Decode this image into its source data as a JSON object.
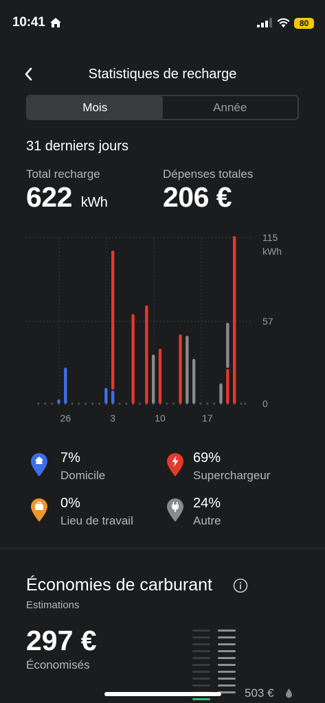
{
  "status_bar": {
    "time": "10:41",
    "battery": "80"
  },
  "header": {
    "title": "Statistiques de recharge"
  },
  "tabs": [
    {
      "label": "Mois",
      "active": true
    },
    {
      "label": "Année",
      "active": false
    }
  ],
  "period": "31 derniers jours",
  "totals": {
    "charge_label": "Total recharge",
    "charge_value": "622",
    "charge_unit": "kWh",
    "spend_label": "Dépenses totales",
    "spend_value": "206 €"
  },
  "chart_data": {
    "type": "bar",
    "ylim": [
      0,
      115
    ],
    "y_ticks": [
      "0",
      "57",
      "115"
    ],
    "y_unit": "kWh",
    "x_ticks": [
      {
        "label": "26",
        "day": 5
      },
      {
        "label": "3",
        "day": 12
      },
      {
        "label": "10",
        "day": 19
      },
      {
        "label": "17",
        "day": 26
      }
    ],
    "days": 31,
    "series": [
      {
        "name": "Domicile",
        "color": "#3e6ee8",
        "points": [
          {
            "day": 4,
            "value": 3
          },
          {
            "day": 5,
            "value": 25
          },
          {
            "day": 11,
            "value": 11
          },
          {
            "day": 12,
            "value": 9
          }
        ]
      },
      {
        "name": "Superchargeur",
        "color": "#e5392b",
        "points": [
          {
            "day": 12,
            "value": 97
          },
          {
            "day": 15,
            "value": 62
          },
          {
            "day": 17,
            "value": 68
          },
          {
            "day": 19,
            "value": 38
          },
          {
            "day": 22,
            "value": 48
          },
          {
            "day": 29,
            "value": 24
          },
          {
            "day": 30,
            "value": 116
          }
        ]
      },
      {
        "name": "Autre",
        "color": "#8a8a8c",
        "points": [
          {
            "day": 18,
            "value": 34
          },
          {
            "day": 23,
            "value": 47
          },
          {
            "day": 24,
            "value": 31
          },
          {
            "day": 28,
            "value": 14
          },
          {
            "day": 29,
            "value": 32
          }
        ]
      }
    ]
  },
  "breakdown": [
    {
      "pct": "7%",
      "name": "Domicile",
      "color": "#3e6ee8",
      "icon": "home-icon"
    },
    {
      "pct": "69%",
      "name": "Superchargeur",
      "color": "#e5392b",
      "icon": "lightning-icon"
    },
    {
      "pct": "0%",
      "name": "Lieu de travail",
      "color": "#f0962a",
      "icon": "briefcase-icon"
    },
    {
      "pct": "24%",
      "name": "Autre",
      "color": "#8a8a8c",
      "icon": "plug-icon"
    }
  ],
  "savings": {
    "title": "Économies de carburant",
    "subtitle": "Estimations",
    "value": "297 €",
    "value_label": "Économisés",
    "compare_value": "503 €"
  }
}
